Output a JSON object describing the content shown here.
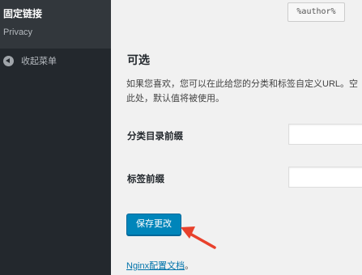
{
  "sidebar": {
    "current_item": "固定链接",
    "items": [
      {
        "label": "Privacy"
      }
    ],
    "collapse_label": "收起菜单"
  },
  "main": {
    "author_tag": "%author%",
    "section_title": "可选",
    "description": "如果您喜欢，您可以在此给您的分类和标签自定义URL。空此处，默认值将被使用。",
    "fields": [
      {
        "label": "分类目录前缀",
        "value": ""
      },
      {
        "label": "标签前缀",
        "value": ""
      }
    ],
    "save_label": "保存更改",
    "doc_link": {
      "text": "Nginx配置文档",
      "suffix": "。"
    }
  },
  "colors": {
    "sidebar_bg": "#23282d",
    "submenu_bg": "#32373c",
    "primary_button": "#0085ba",
    "annotation_arrow": "#e8412c"
  }
}
